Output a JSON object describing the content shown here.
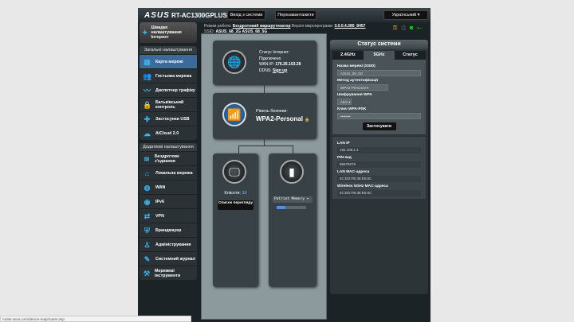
{
  "header": {
    "logo": "ASUS",
    "model": "RT-AC1300GPLUS",
    "logout": "Вихід з системи",
    "reboot": "Перезавантажити",
    "language": "Український"
  },
  "info": {
    "mode_label": "Режим роботи:",
    "mode": "Бездротовий маршрутизатор",
    "fw_label": "Версія мікропрограми:",
    "fw": "3.0.0.4.380_8457",
    "ssid_label": "SSID:",
    "ssid1": "ASUS_68_2G",
    "ssid2": "ASUS_68_5G"
  },
  "sidebar": {
    "wizard": "Швидке налаштування Інтернет",
    "general_title": "Загальні налаштування",
    "general": [
      {
        "label": "Карта мережі",
        "icon": "network-map-icon",
        "sym": "▦"
      },
      {
        "label": "Гостьова мережа",
        "icon": "guest-network-icon",
        "sym": "👥"
      },
      {
        "label": "Диспетчер трафіку",
        "icon": "traffic-manager-icon",
        "sym": "〰"
      },
      {
        "label": "Батьківський контроль",
        "icon": "lock-icon",
        "sym": "🔒"
      },
      {
        "label": "Застосунки USB",
        "icon": "puzzle-icon",
        "sym": "✚"
      },
      {
        "label": "AiCloud 2.0",
        "icon": "cloud-icon",
        "sym": "☁"
      }
    ],
    "advanced_title": "Додаткові налаштування",
    "advanced": [
      {
        "label": "Бездротове з'єднання",
        "icon": "wifi-icon",
        "sym": "≋"
      },
      {
        "label": "Локальна мережа",
        "icon": "home-icon",
        "sym": "⌂"
      },
      {
        "label": "WAN",
        "icon": "globe-icon",
        "sym": "◍"
      },
      {
        "label": "IPv6",
        "icon": "ipv6-icon",
        "sym": "◉"
      },
      {
        "label": "VPN",
        "icon": "vpn-icon",
        "sym": "⇄"
      },
      {
        "label": "Брандмауер",
        "icon": "shield-icon",
        "sym": "⛨"
      },
      {
        "label": "Адміністрування",
        "icon": "admin-icon",
        "sym": "♙"
      },
      {
        "label": "Системний журнал",
        "icon": "log-icon",
        "sym": "✎"
      },
      {
        "label": "Мережеві інструменти",
        "icon": "tools-icon",
        "sym": "⚒"
      }
    ]
  },
  "map": {
    "inet_status_label": "Статус Інтернет:",
    "inet_status": "Підключено",
    "wan_ip_label": "WAN IP:",
    "wan_ip": "176.26.103.28",
    "ddns_label": "DDNS:",
    "ddns": "Sign up",
    "security_label": "Рівень безпеки:",
    "security": "WPA2-Personal",
    "clients_label": "Клієнти:",
    "clients": "10",
    "client_list": "Список перегляду",
    "usb_device": "Patriot Memory",
    "usb_progress": 0.3
  },
  "system": {
    "title": "Статус системи",
    "tabs": [
      "2.4GHz",
      "5GHz",
      "Статус"
    ],
    "ssid_label": "Назва мережі (SSID)",
    "ssid": "ASUS_68_5G",
    "auth_label": "Метод аутентифікації",
    "auth": "WPA2-Personal",
    "enc_label": "Шифрування WPA",
    "enc": "AES",
    "key_label": "Ключ WPA-PSK",
    "key": "••••••••",
    "apply": "Застосувати",
    "lan_ip_label": "LAN IP",
    "lan_ip": "192.168.1.1",
    "pin_label": "PIN-код",
    "pin": "86679275",
    "lan_mac_label": "LAN MAC-адреса",
    "lan_mac": "4C:ED:FB:38:E5:6C",
    "wl_mac_label": "Wireless 5GHz MAC-адреса",
    "wl_mac": "4C:ED:FB:38:E5:6C"
  },
  "statusbar": "router.asus.com/device-map/router.asp"
}
